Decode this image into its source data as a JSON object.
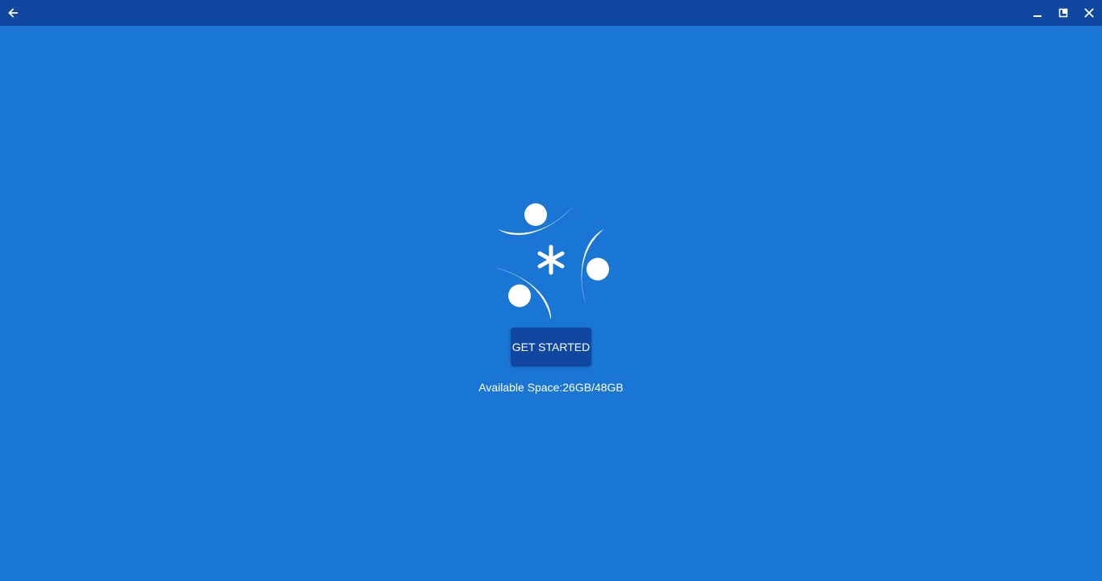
{
  "window": {
    "back_icon": "arrow-left-icon",
    "minimize_icon": "minimize-icon",
    "restore_icon": "restore-icon",
    "close_icon": "close-icon"
  },
  "colors": {
    "background": "#1976d5",
    "titlebar": "#0f47a1",
    "button": "#0f47a1",
    "text": "#ffffff"
  },
  "main": {
    "logo_icon": "app-logo-icon",
    "get_started_label": "GET STARTED",
    "available_space": "Available Space:26GB/48GB"
  }
}
